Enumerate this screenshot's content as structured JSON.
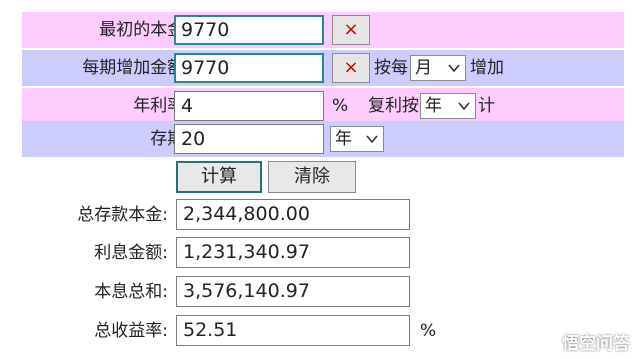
{
  "row1": {
    "label": "最初的本金:",
    "value": "9770",
    "clear": "×"
  },
  "row2": {
    "label": "每期增加金额:",
    "value": "9770",
    "clear": "×",
    "prefix": "按每",
    "period": "月",
    "suffix": "增加"
  },
  "row3": {
    "label": "年利率:",
    "value": "4",
    "unit": "%",
    "compound_label": "复利按",
    "compound_period": "年",
    "compound_suffix": "计"
  },
  "row4": {
    "label": "存期:",
    "value": "20",
    "unit": "年"
  },
  "buttons": {
    "calculate": "计算",
    "clear": "清除"
  },
  "results": {
    "total_principal_label": "总存款本金:",
    "total_principal": "2,344,800.00",
    "interest_label": "利息金额:",
    "interest": "1,231,340.97",
    "total_label": "本息总和:",
    "total": "3,576,140.97",
    "yield_label": "总收益率:",
    "yield": "52.51",
    "yield_unit": "%"
  },
  "watermark": {
    "text": "悟空问答"
  },
  "colors": {
    "pink_band": "#ffccff",
    "blue_band": "#ccccff",
    "clear_x": "#d00000",
    "focus_border": "#2a8a8a"
  }
}
